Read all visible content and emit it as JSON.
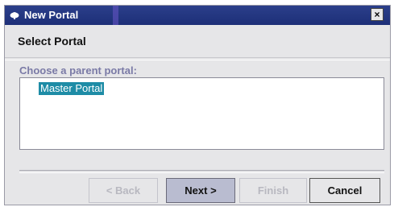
{
  "window": {
    "title": "New Portal",
    "close_label": "×"
  },
  "wizard": {
    "heading": "Select Portal",
    "prompt": "Choose a parent portal:",
    "portals": [
      {
        "label": "Master Portal",
        "selected": true
      }
    ]
  },
  "buttons": {
    "back": {
      "label": "< Back",
      "enabled": false
    },
    "next": {
      "label": "Next >",
      "enabled": true
    },
    "finish": {
      "label": "Finish",
      "enabled": false
    },
    "cancel": {
      "label": "Cancel",
      "enabled": true
    }
  },
  "colors": {
    "titlebar": "#1d2f78",
    "selection": "#1e8ca6",
    "prompt_text": "#7a7aa6"
  },
  "icons": {
    "app": "portal-app-icon",
    "close": "close-icon"
  }
}
